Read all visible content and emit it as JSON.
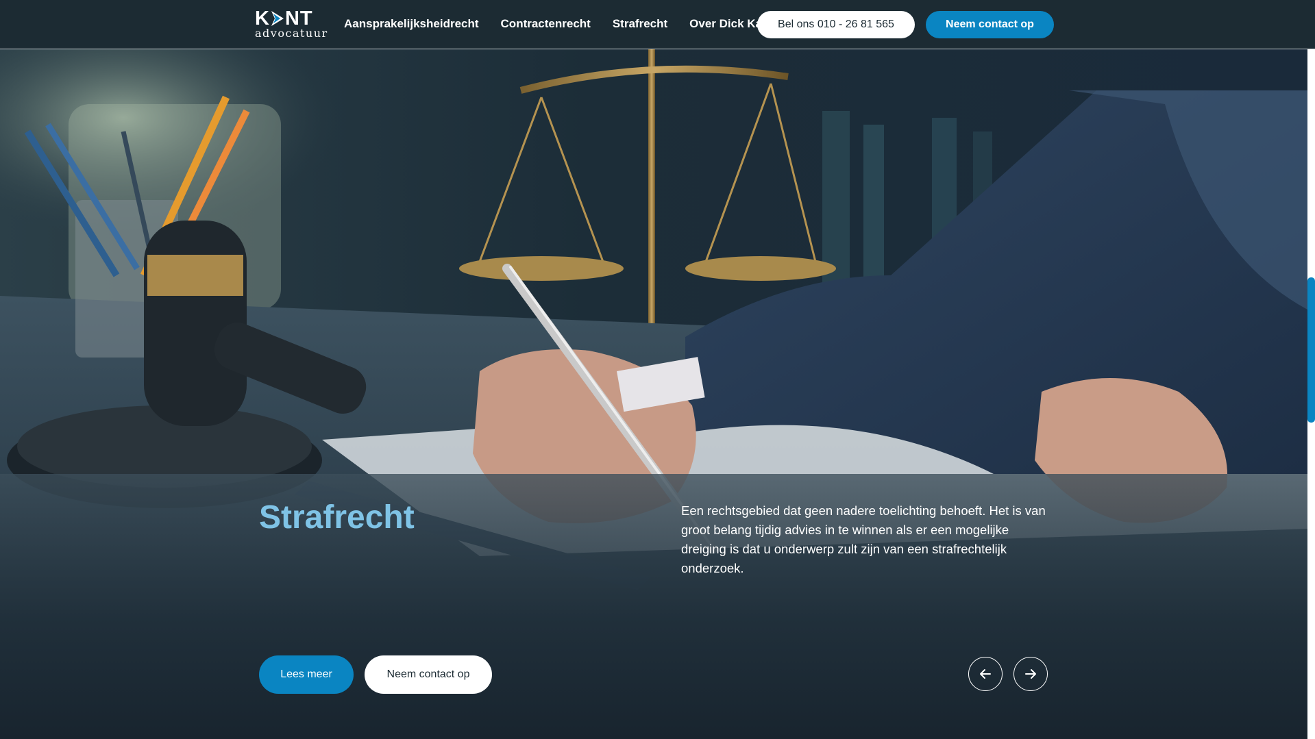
{
  "header": {
    "logo": {
      "text_left": "K",
      "text_right": "NT",
      "subtitle": "advocatuur"
    },
    "nav": [
      {
        "label": "Aansprakelijksheidrecht"
      },
      {
        "label": "Contractenrecht"
      },
      {
        "label": "Strafrecht"
      },
      {
        "label": "Over Dick Kant"
      }
    ],
    "call_button": "Bel ons 010 - 26 81 565",
    "contact_button": "Neem contact op"
  },
  "hero": {
    "title": "Strafrecht",
    "description": "Een rechtsgebied dat geen nadere toelichting behoeft. Het is van groot belang tijdig advies in te winnen als er een mogelijke dreiging is dat u onderwerp zult zijn van een strafrechtelijk onderzoek.",
    "read_more_button": "Lees meer",
    "contact_button": "Neem contact op",
    "prev_icon": "arrow-left-icon",
    "next_icon": "arrow-right-icon"
  },
  "colors": {
    "header_bg": "#1c2b33",
    "accent": "#0a85c2",
    "title": "#7fc3e6",
    "white": "#ffffff"
  }
}
